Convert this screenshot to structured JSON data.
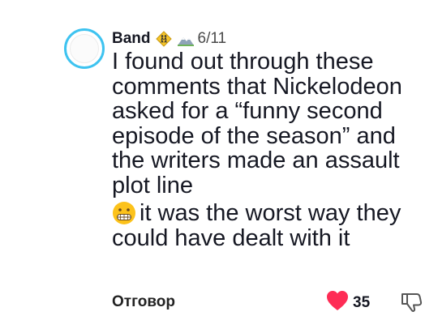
{
  "comment": {
    "author": "Band",
    "badge_icons": [
      "pedestrian-crossing-sign-icon",
      "mountain-icon"
    ],
    "date": "6/11",
    "text_line_1": "I found out through these comments that Nickelodeon asked for a “funny second episode of the season” and the writers made an assault plot line",
    "emoji_icon": "grimacing-face-emoji-icon",
    "text_line_2": "it was the worst way they could have dealt with it",
    "reply_label": "Отговор",
    "like_count": "35"
  },
  "colors": {
    "avatar_ring": "#3ec3f0",
    "heart": "#fe2c55",
    "text": "#161823"
  }
}
